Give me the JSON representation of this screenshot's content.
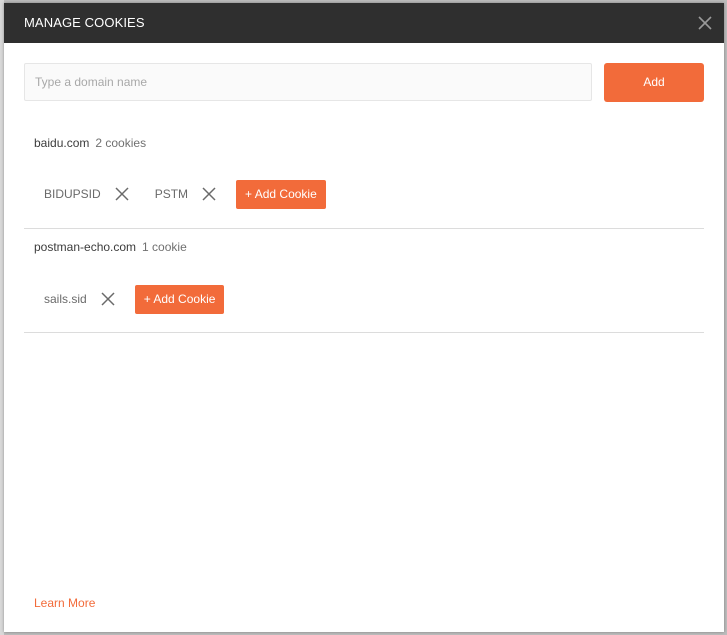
{
  "modal": {
    "title": "MANAGE COOKIES"
  },
  "search": {
    "placeholder": "Type a domain name",
    "value": ""
  },
  "add_button": {
    "label": "Add"
  },
  "domains": [
    {
      "name": "baidu.com",
      "count_label": "2 cookies",
      "cookies": [
        "BIDUPSID",
        "PSTM"
      ],
      "add_cookie_label": "+ Add Cookie"
    },
    {
      "name": "postman-echo.com",
      "count_label": "1 cookie",
      "cookies": [
        "sails.sid"
      ],
      "add_cookie_label": "+ Add Cookie"
    }
  ],
  "footer": {
    "learn_more": "Learn More"
  },
  "colors": {
    "accent": "#f26b3a",
    "header_bg": "#2f2f2f"
  },
  "icons": {
    "close": "close-icon",
    "remove_cookie": "remove-cookie-icon"
  }
}
